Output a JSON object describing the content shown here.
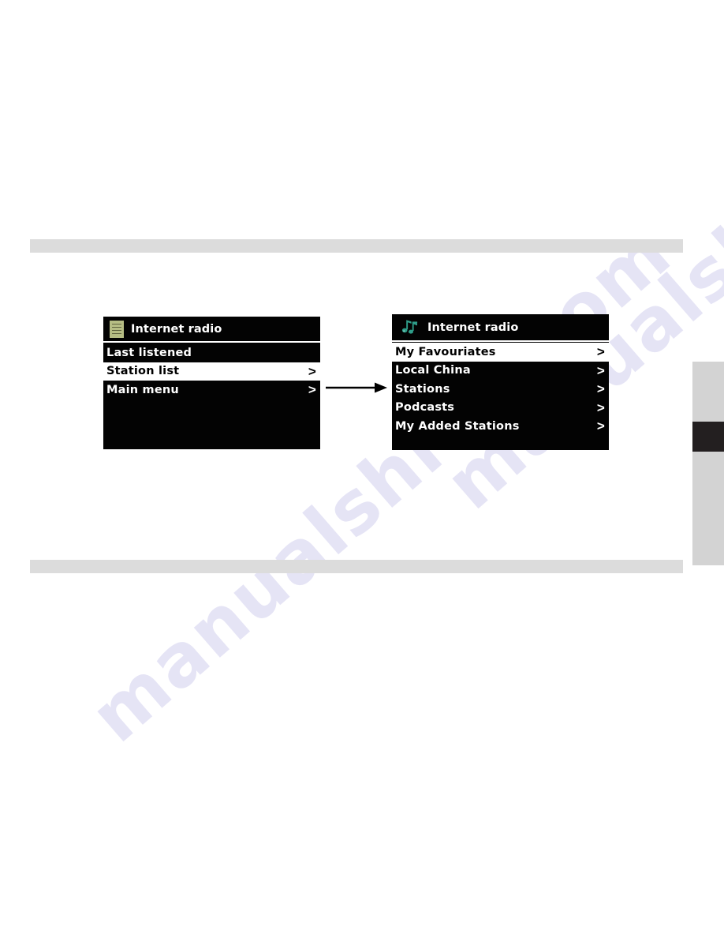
{
  "page": {
    "background_color": "#ffffff",
    "watermark_text": "manualshive.com",
    "watermark_color": "#6a62c8"
  },
  "separators": {
    "color": "#dcdcdc",
    "top_label": "section-divider-top",
    "bottom_label": "section-divider-bottom"
  },
  "tab_strip": {
    "background_color": "#d3d3d3",
    "active_color": "#231f20"
  },
  "flow": {
    "arrow_label": "flow-arrow-right",
    "arrow_color": "#000000"
  },
  "screens": [
    {
      "id": "internet-radio-menu",
      "title": "Internet radio",
      "icon": "list-icon",
      "icon_color": "#b6bd84",
      "background_color": "#030303",
      "items": [
        {
          "label": "Last listened",
          "chevron": "",
          "selected": false
        },
        {
          "label": "Station list",
          "chevron": ">",
          "selected": true
        },
        {
          "label": "Main menu",
          "chevron": ">",
          "selected": false
        }
      ]
    },
    {
      "id": "internet-radio-station-list",
      "title": "Internet radio",
      "icon": "music-notes-icon",
      "icon_color": "#2f9e8a",
      "background_color": "#030303",
      "items": [
        {
          "label": "My Favouriates",
          "chevron": ">",
          "selected": true
        },
        {
          "label": "Local China",
          "chevron": ">",
          "selected": false
        },
        {
          "label": "Stations",
          "chevron": ">",
          "selected": false
        },
        {
          "label": "Podcasts",
          "chevron": ">",
          "selected": false
        },
        {
          "label": "My Added Stations",
          "chevron": ">",
          "selected": false
        }
      ]
    }
  ]
}
